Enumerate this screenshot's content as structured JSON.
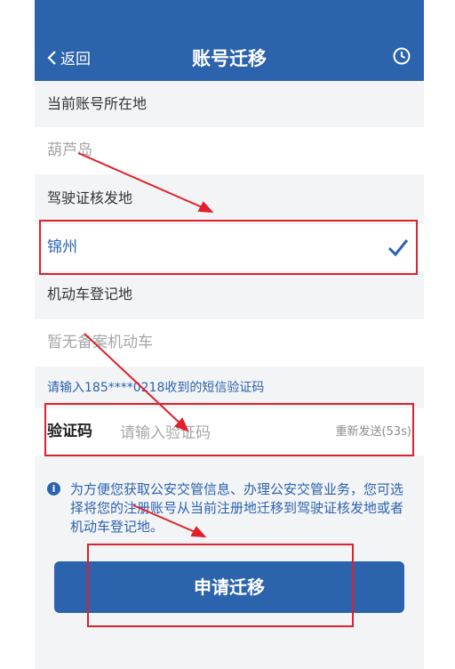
{
  "header": {
    "back_label": "返回",
    "title": "账号迁移",
    "clock_icon": "clock-icon"
  },
  "fields": {
    "current_location_label": "当前账号所在地",
    "current_location_value": "葫芦岛",
    "license_issue_label": "驾驶证核发地",
    "license_issue_value": "锦州",
    "vehicle_register_label": "机动车登记地",
    "vehicle_register_value": "暂无备案机动车"
  },
  "sms": {
    "hint": "请输入185****0218收到的短信验证码",
    "code_label": "验证码",
    "code_placeholder": "请输入验证码",
    "resend_label": "重新发送(53s)"
  },
  "notice": {
    "text": "为方便您获取公安交管信息、办理公安交管业务，您可选择将您的注册账号从当前注册地迁移到驾驶证核发地或者机动车登记地。"
  },
  "apply_button": {
    "label": "申请迁移"
  },
  "colors": {
    "brand_blue": "#2c63ad",
    "annotation_red": "#e0202a",
    "muted_gray": "#a6a6a6"
  }
}
